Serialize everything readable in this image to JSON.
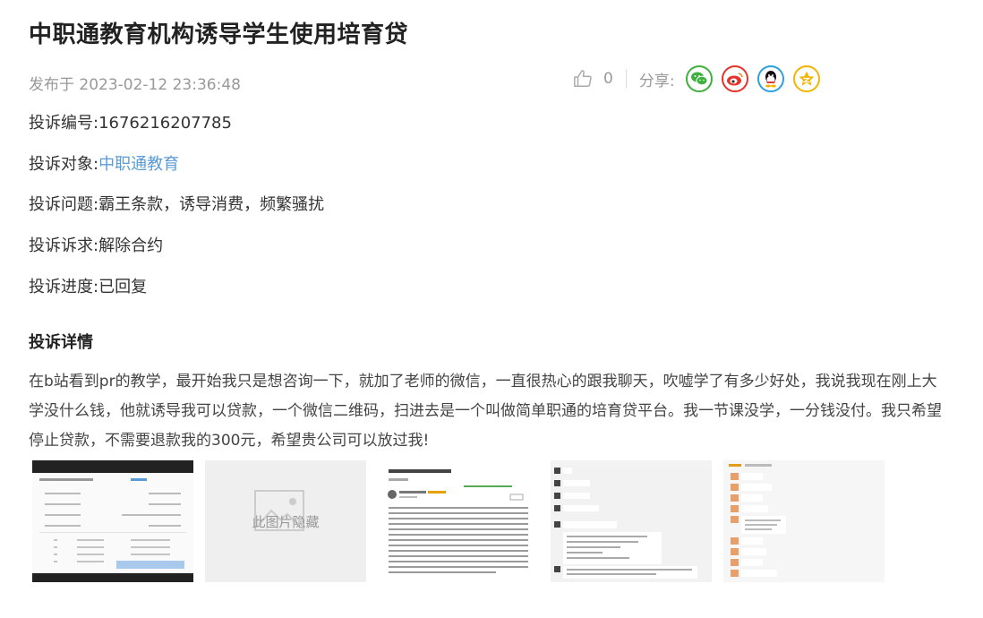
{
  "title": "中职通教育机构诱导学生使用培育贷",
  "publish": "发布于 2023-02-12 23:36:48",
  "likes": "0",
  "share_label": "分享:",
  "share_icons": [
    "wechat-icon",
    "weibo-icon",
    "qq-icon",
    "qzone-icon"
  ],
  "info": {
    "id_label": "投诉编号:",
    "id_value": "1676216207785",
    "target_label": "投诉对象:",
    "target_value": "中职通教育",
    "issue_label": "投诉问题:",
    "issue_value": "霸王条款，诱导消费，频繁骚扰",
    "demand_label": "投诉诉求:",
    "demand_value": "解除合约",
    "progress_label": "投诉进度:",
    "progress_value": "已回复"
  },
  "detail_title": "投诉详情",
  "detail_text": "在b站看到pr的教学，最开始我只是想咨询一下，就加了老师的微信，一直很热心的跟我聊天，吹嘘学了有多少好处，我说我现在刚上大学没什么钱，他就诱导我可以贷款，一个微信二维码，扫进去是一个叫做简单职通的培育贷平台。我一节课没学，一分钱没付。我只希望停止贷款，不需要退款我的300元，希望贵公司可以放过我!",
  "hidden_image_text": "此图片隐藏",
  "colors": {
    "link": "#5b9bd5",
    "wechat": "#3db03d",
    "weibo": "#e6332a",
    "qq": "#2da0e0",
    "qzone": "#f5b400"
  }
}
